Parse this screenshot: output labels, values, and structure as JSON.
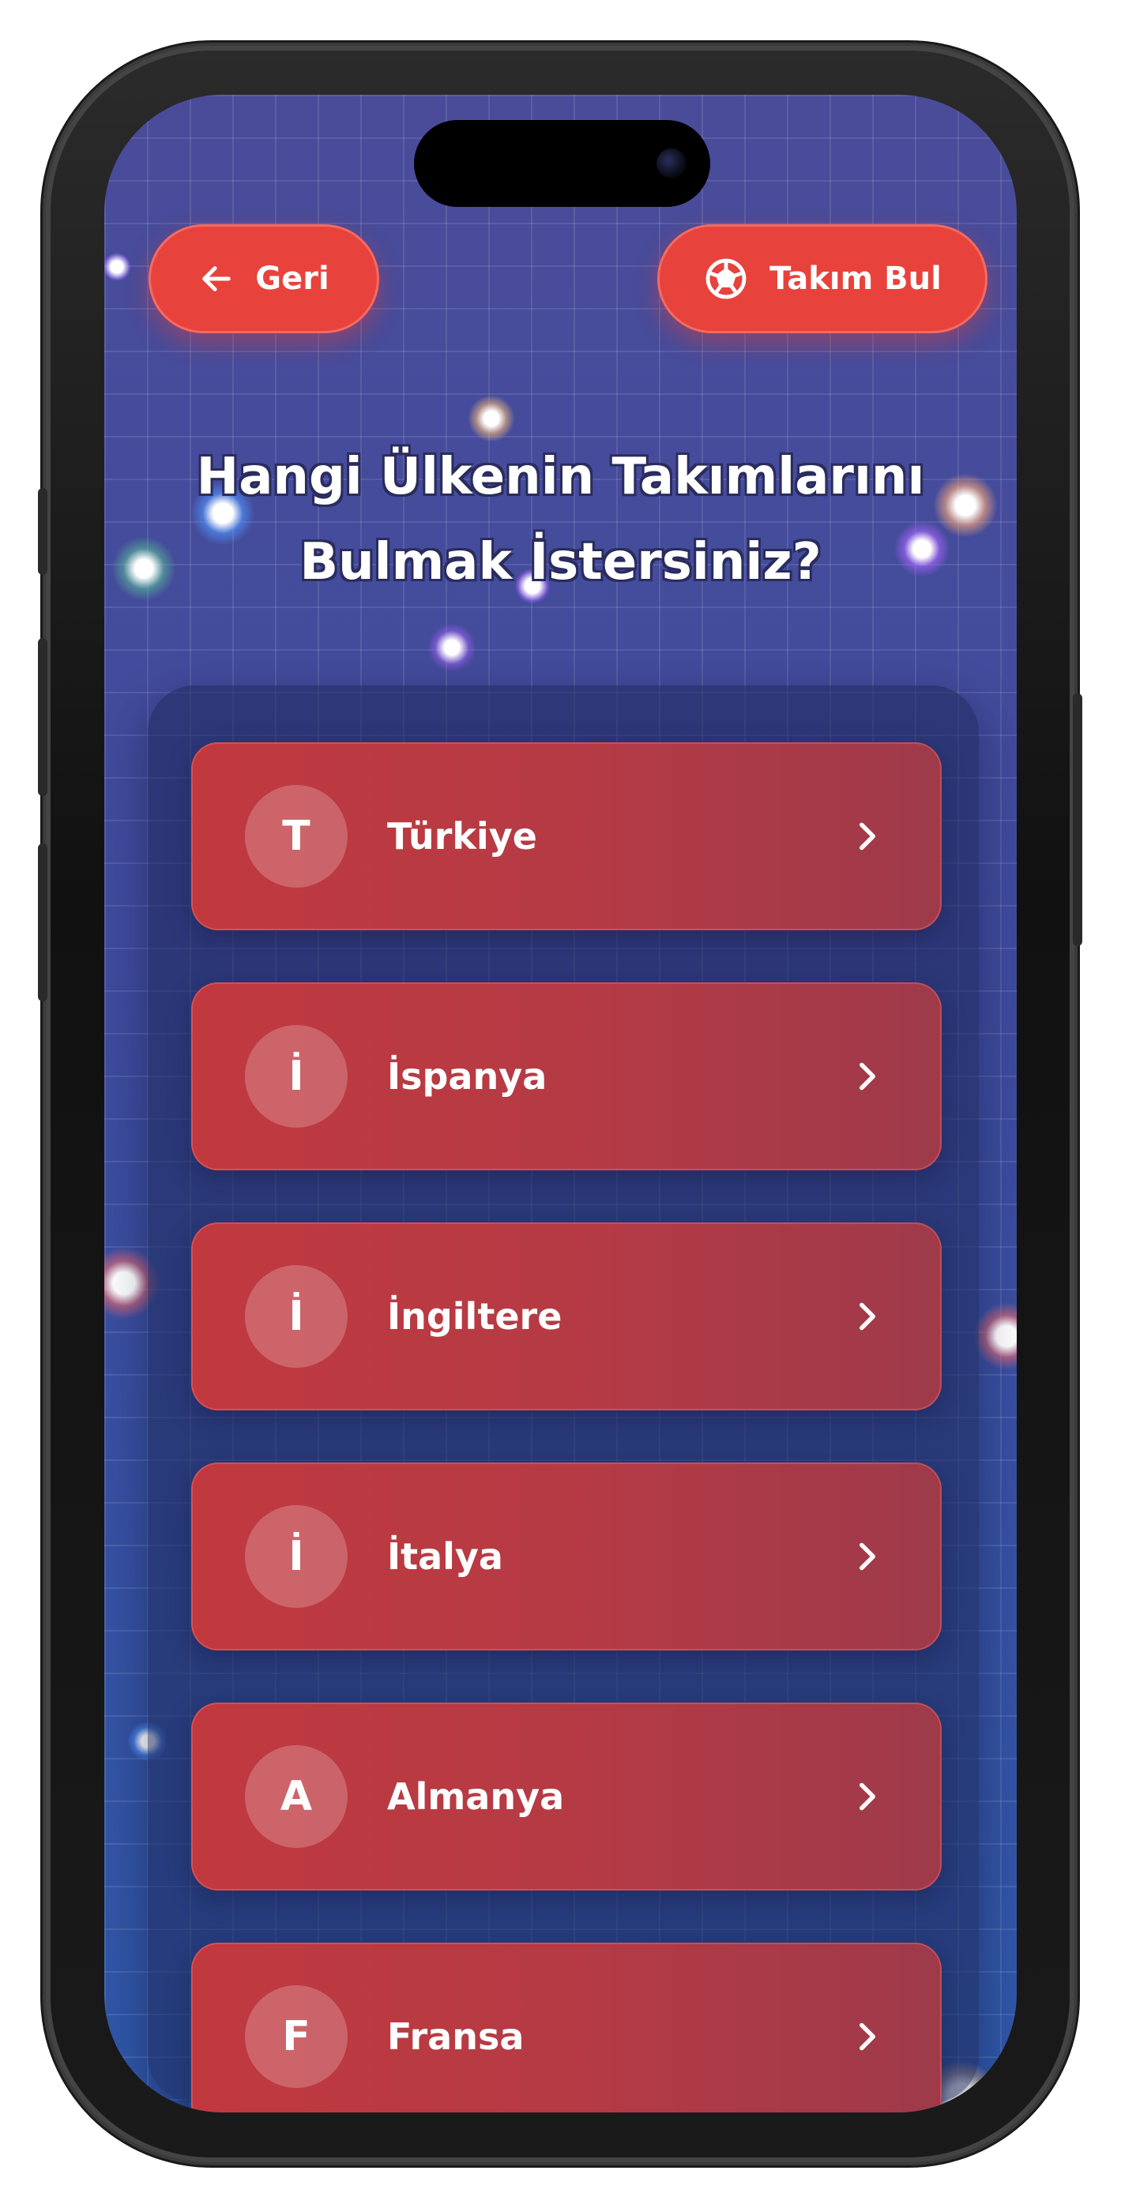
{
  "header": {
    "back_label": "Geri",
    "find_team_label": "Takım Bul"
  },
  "title": {
    "line1": "Hangi Ülkenin Takımlarını",
    "line2": "Bulmak İstersiniz?"
  },
  "countries": [
    {
      "initial": "T",
      "name": "Türkiye"
    },
    {
      "initial": "İ",
      "name": "İspanya"
    },
    {
      "initial": "İ",
      "name": "İngiltere"
    },
    {
      "initial": "İ",
      "name": "İtalya"
    },
    {
      "initial": "A",
      "name": "Almanya"
    },
    {
      "initial": "F",
      "name": "Fransa"
    }
  ],
  "icons": {
    "back": "arrow-left-icon",
    "find": "soccer-ball-icon",
    "item": "chevron-right-icon"
  },
  "colors": {
    "accent": "#e8423c",
    "card": "#b43a45",
    "background": "#4a4c9a"
  }
}
